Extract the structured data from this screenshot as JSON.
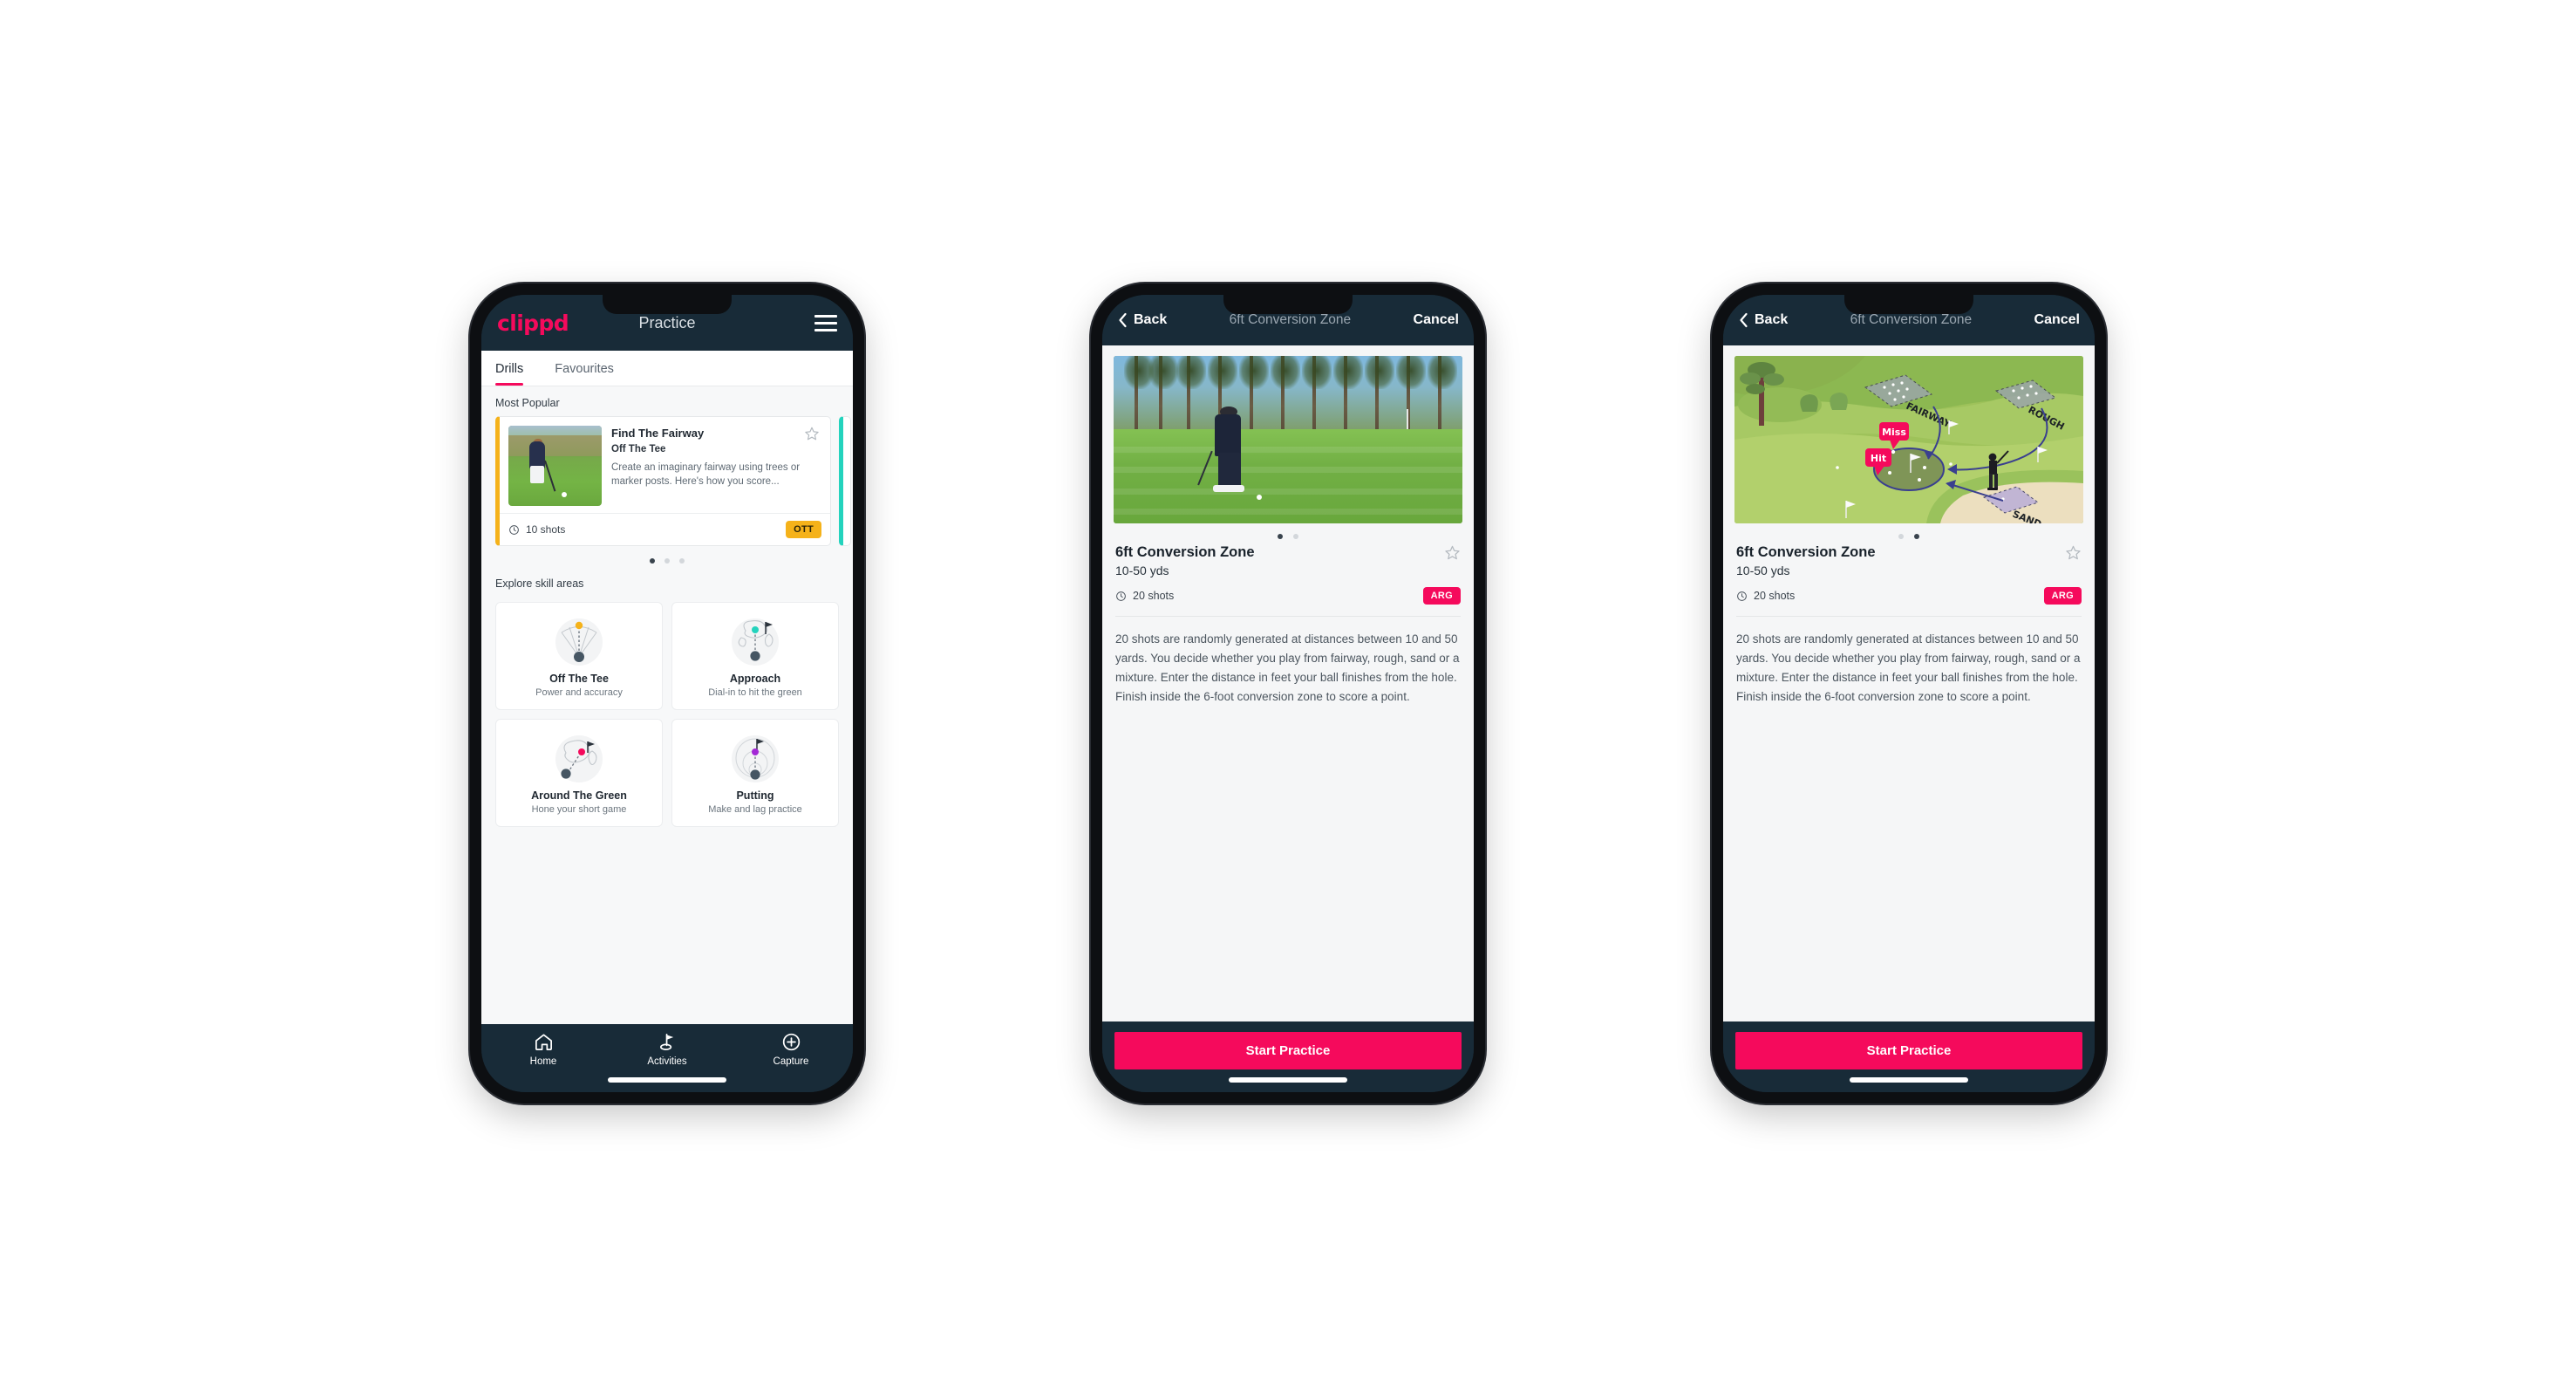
{
  "colors": {
    "brand_pink": "#f50a5c",
    "header_navy": "#182b38",
    "badge_amber": "#f5b21a",
    "badge_pink": "#f50a5c",
    "teal_accent": "#24d3bd",
    "page_bg": "#f7f8f9"
  },
  "screen1": {
    "appbar": {
      "brand": "clippd",
      "title": "Practice",
      "menu_icon": "hamburger-icon"
    },
    "tabs": [
      {
        "label": "Drills",
        "active": true
      },
      {
        "label": "Favourites",
        "active": false
      }
    ],
    "most_popular": {
      "section_label": "Most Popular",
      "card": {
        "title": "Find The Fairway",
        "subtitle": "Off The Tee",
        "description": "Create an imaginary fairway using trees or marker posts. Here's how you score...",
        "shots": "10 shots",
        "badge": "OTT",
        "favourite_icon": "star-outline-icon",
        "clock_icon": "clock-icon",
        "accent": "#f5b21a"
      },
      "dots": {
        "count": 3,
        "active_index": 0
      }
    },
    "explore": {
      "section_label": "Explore skill areas",
      "cards": [
        {
          "name": "Off The Tee",
          "desc": "Power and accuracy",
          "icon": "dispersion-cone-icon",
          "dot_color": "#f5b21a"
        },
        {
          "name": "Approach",
          "desc": "Dial-in to hit the green",
          "icon": "green-target-icon",
          "dot_color": "#24d3bd"
        },
        {
          "name": "Around The Green",
          "desc": "Hone your short game",
          "icon": "chip-to-green-icon",
          "dot_color": "#f50a5c"
        },
        {
          "name": "Putting",
          "desc": "Make and lag practice",
          "icon": "putting-rings-icon",
          "dot_color": "#a428d6"
        }
      ]
    },
    "bottom_nav": [
      {
        "label": "Home",
        "icon": "home-icon",
        "active": false
      },
      {
        "label": "Activities",
        "icon": "golf-flag-icon",
        "active": true
      },
      {
        "label": "Capture",
        "icon": "plus-circle-icon",
        "active": false
      }
    ]
  },
  "screen2": {
    "appbar": {
      "back_label": "Back",
      "back_icon": "chevron-left-icon",
      "title": "6ft Conversion Zone",
      "cancel_label": "Cancel"
    },
    "media": {
      "type": "photo",
      "alt": "golfer-chipping-photo"
    },
    "dots": {
      "count": 2,
      "active_index": 0
    },
    "detail": {
      "title": "6ft Conversion Zone",
      "distance": "10-50 yds",
      "shots": "20 shots",
      "badge": "ARG",
      "favourite_icon": "star-outline-icon",
      "clock_icon": "clock-icon",
      "description": "20 shots are randomly generated at distances between 10 and 50 yards. You decide whether you play from fairway, rough, sand or a mixture. Enter the distance in feet your ball finishes from the hole. Finish inside the 6-foot conversion zone to score a point."
    },
    "cta": "Start Practice"
  },
  "screen3": {
    "appbar": {
      "back_label": "Back",
      "back_icon": "chevron-left-icon",
      "title": "6ft Conversion Zone",
      "cancel_label": "Cancel"
    },
    "media": {
      "type": "illustration",
      "alt": "golf-hole-diagram",
      "labels": [
        "FAIRWAY",
        "ROUGH",
        "SAND"
      ],
      "markers": [
        {
          "text": "Miss",
          "color": "#f50a5c"
        },
        {
          "text": "Hit",
          "color": "#f50a5c"
        }
      ]
    },
    "dots": {
      "count": 2,
      "active_index": 1
    },
    "detail": {
      "title": "6ft Conversion Zone",
      "distance": "10-50 yds",
      "shots": "20 shots",
      "badge": "ARG",
      "favourite_icon": "star-outline-icon",
      "clock_icon": "clock-icon",
      "description": "20 shots are randomly generated at distances between 10 and 50 yards. You decide whether you play from fairway, rough, sand or a mixture. Enter the distance in feet your ball finishes from the hole. Finish inside the 6-foot conversion zone to score a point."
    },
    "cta": "Start Practice"
  }
}
